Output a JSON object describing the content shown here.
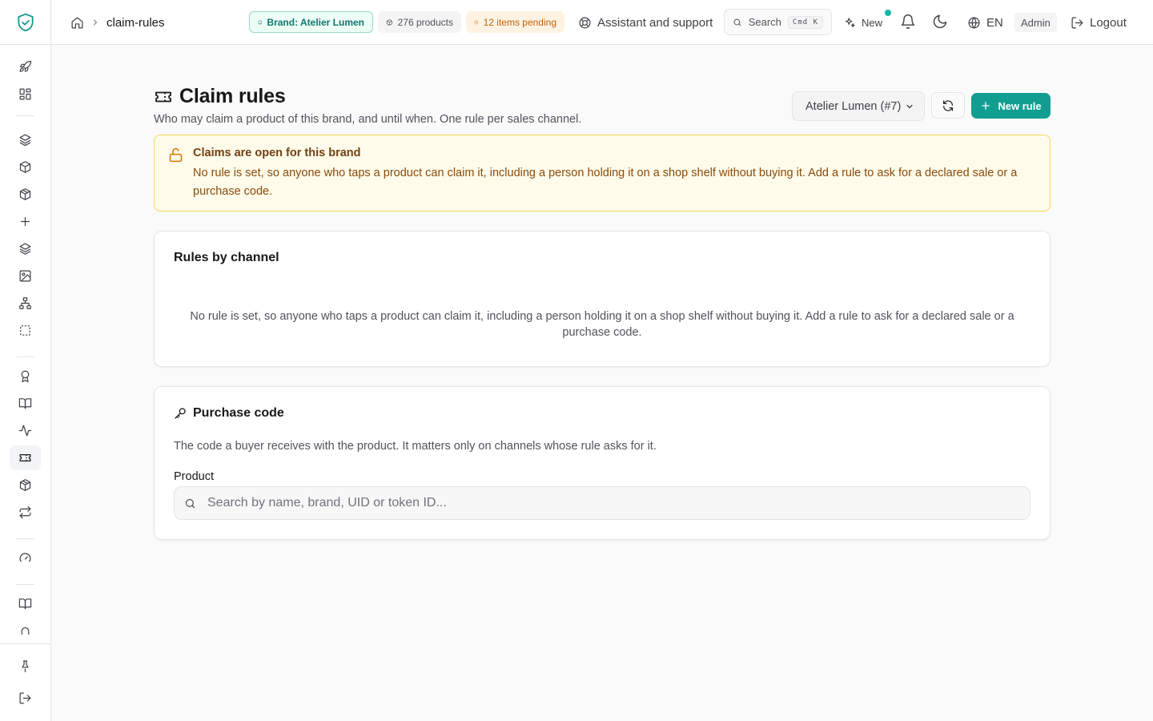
{
  "breadcrumb": {
    "current": "claim-rules"
  },
  "header": {
    "brand_pill": "Brand: Atelier Lumen",
    "products_pill": "276 products",
    "pending_pill": "12 items pending",
    "support_label": "Assistant and support",
    "search_label": "Search",
    "search_shortcut": "Cmd K",
    "new_label": "New",
    "language": "EN",
    "role_badge": "Admin",
    "logout_label": "Logout",
    "accent_color": "#0d9488"
  },
  "sidebar": {
    "icons": [
      "shield-check-icon",
      "rocket-icon",
      "dashboard-grid-icon",
      "layers-icon",
      "box-icon",
      "package-icon",
      "plus-icon",
      "layers-stack-icon",
      "image-icon",
      "network-icon",
      "dashed-square-icon",
      "award-icon",
      "book-open-icon",
      "activity-icon",
      "ticket-icon",
      "package-check-icon",
      "repeat-icon",
      "gauge-icon",
      "book-icon",
      "arch-icon",
      "pin-icon",
      "sign-out-icon"
    ],
    "active_item": "ticket-icon"
  },
  "page": {
    "title": "Claim rules",
    "subtitle": "Who may claim a product of this brand, and until when. One rule per sales channel.",
    "brand_select_value": "Atelier Lumen (#7)",
    "new_rule_label": "New rule"
  },
  "alert": {
    "title": "Claims are open for this brand",
    "body": "No rule is set, so anyone who taps a product can claim it, including a person holding it on a shop shelf without buying it. Add a rule to ask for a declared sale or a purchase code."
  },
  "rules_card": {
    "title": "Rules by channel",
    "empty_text": "No rule is set, so anyone who taps a product can claim it, including a person holding it on a shop shelf without buying it. Add a rule to ask for a declared sale or a purchase code."
  },
  "purchase_code_card": {
    "title": "Purchase code",
    "description": "The code a buyer receives with the product. It matters only on channels whose rule asks for it.",
    "field_label": "Product",
    "search_placeholder": "Search by name, brand, UID or token ID...",
    "search_value": ""
  }
}
